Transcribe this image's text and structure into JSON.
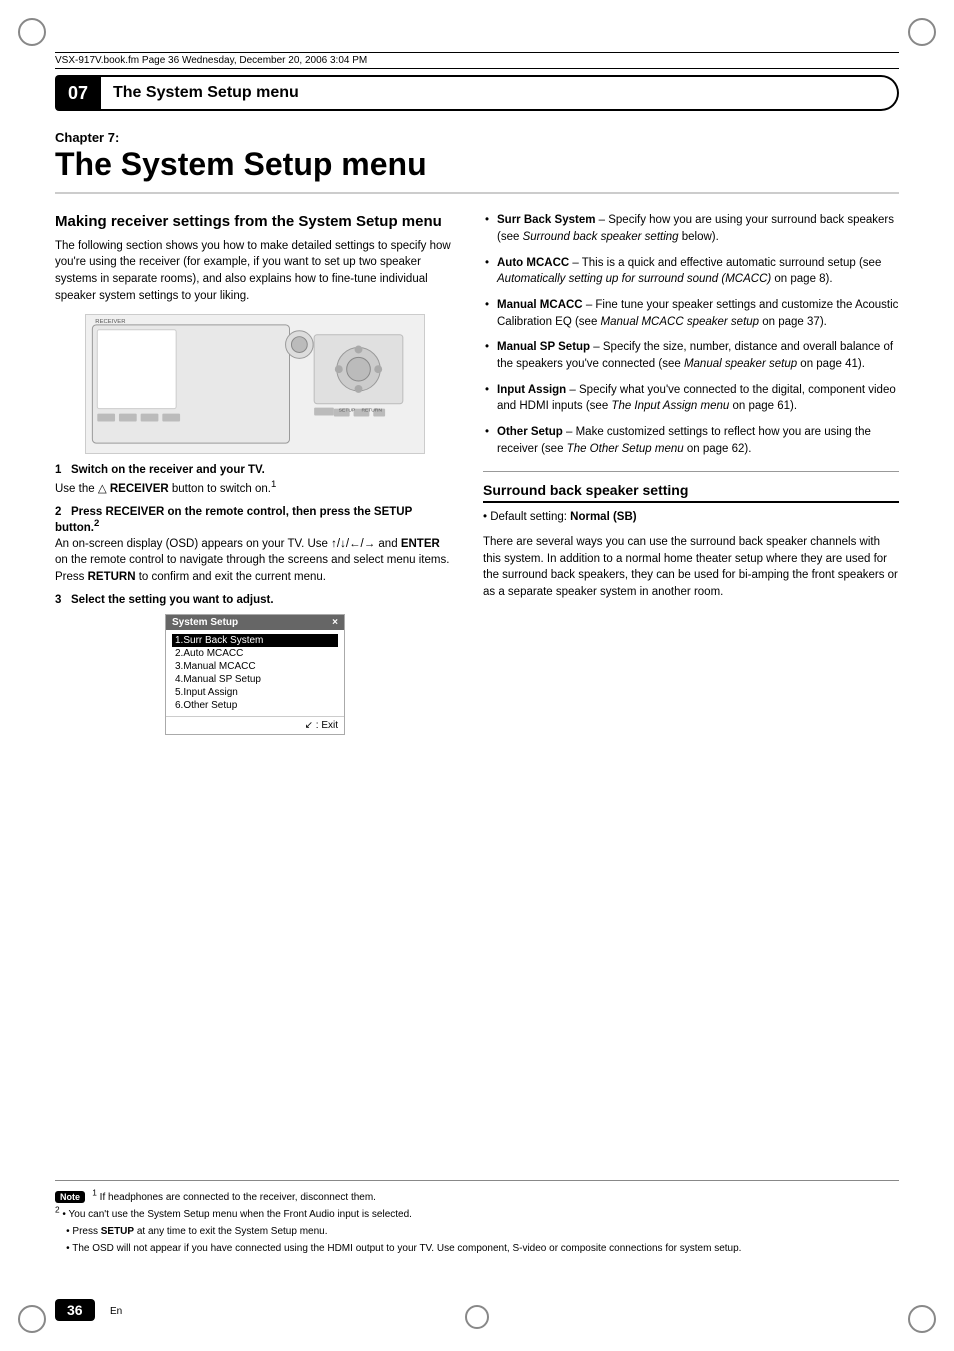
{
  "page": {
    "file_info": "VSX-917V.book.fm  Page 36  Wednesday, December 20, 2006  3:04 PM",
    "chapter_number": "07",
    "chapter_title": "The System Setup menu",
    "chapter_label": "Chapter 7:",
    "chapter_main_title": "The System Setup menu",
    "page_number": "36",
    "page_en": "En"
  },
  "left_col": {
    "section_heading": "Making receiver settings from the System Setup menu",
    "intro_text": "The following section shows you how to make detailed settings to specify how you're using the receiver (for example, if you want to set up two speaker systems in separate rooms), and also explains how to fine-tune individual speaker system settings to your liking.",
    "step1_title": "Switch on the receiver and your TV.",
    "step1_num": "1",
    "step1_body": "Use the  RECEIVER button to switch on.",
    "step1_superscript": "1",
    "step2_title": "Press RECEIVER on the remote control, then press the SETUP button.",
    "step2_num": "2",
    "step2_superscript": "2",
    "step2_body": "An on-screen display (OSD) appears on your TV. Use ↑/↓/←/→ and ENTER on the remote control to navigate through the screens and select menu items. Press RETURN to confirm and exit the current menu.",
    "step3_title": "Select the setting you want to adjust.",
    "step3_num": "3",
    "setup_menu": {
      "title": "System Setup",
      "items": [
        "1.Surr Back System",
        "2.Auto MCACC",
        "3.Manual MCACC",
        "4.Manual SP Setup",
        "5.Input Assign",
        "6.Other Setup"
      ],
      "selected_index": 0,
      "exit_text": "↙ : Exit"
    }
  },
  "right_col": {
    "bullets": [
      {
        "term": "Surr Back System",
        "text": " – Specify how you are using your surround back speakers (see Surround back speaker setting below)."
      },
      {
        "term": "Auto MCACC",
        "text": " – This is a quick and effective automatic surround setup (see Automatically setting up for surround sound (MCACC) on page 8)."
      },
      {
        "term": "Manual MCACC",
        "text": " – Fine tune your speaker settings and customize the Acoustic Calibration EQ (see Manual MCACC speaker setup on page 37)."
      },
      {
        "term": "Manual SP Setup",
        "text": " – Specify the size, number, distance and overall balance of the speakers you've connected (see Manual speaker setup on page 41)."
      },
      {
        "term": "Input Assign",
        "text": " – Specify what you've connected to the digital, component video and HDMI inputs (see The Input Assign menu on page 61)."
      },
      {
        "term": "Other Setup",
        "text": " – Make customized settings to reflect how you are using the receiver (see The Other Setup menu on page 62)."
      }
    ],
    "surround_heading": "Surround back speaker setting",
    "surround_default": "Default setting: Normal (SB)",
    "surround_body": "There are several ways you can use the surround back speaker channels with this system. In addition to a normal home theater setup where they are used for the surround back speakers, they can be used for bi-amping the front speakers or as a separate speaker system in another room."
  },
  "notes": {
    "label": "Note",
    "items": [
      "If headphones are connected to the receiver, disconnect them.",
      "You can't use the System Setup menu when the Front Audio input is selected.",
      "Press SETUP at any time to exit the System Setup menu.",
      "The OSD will not appear if you have connected using the HDMI output to your TV. Use component, S-video or composite connections for system setup."
    ]
  }
}
